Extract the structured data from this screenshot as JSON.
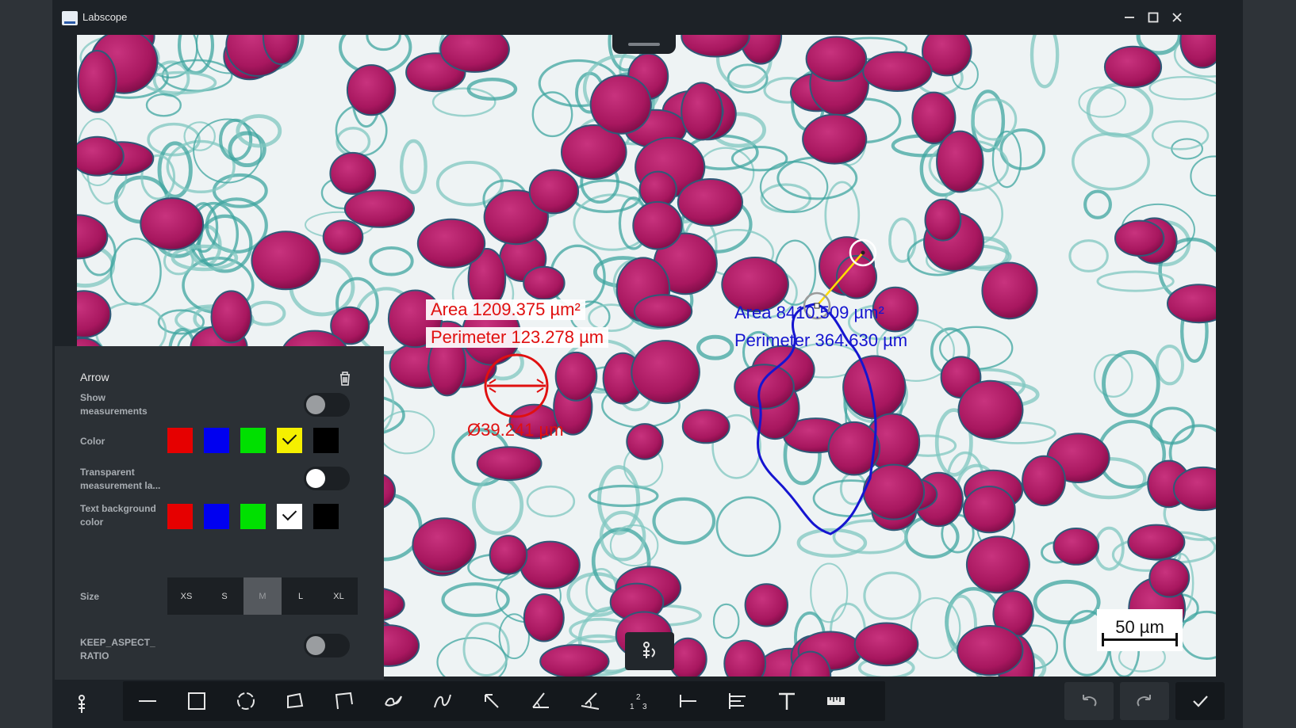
{
  "window": {
    "title": "Labscope",
    "icon": "labscope-app-icon",
    "controls": [
      "minimize-icon",
      "maximize-icon",
      "close-icon"
    ]
  },
  "image": {
    "annotations": {
      "circle": {
        "color": "#e01010",
        "area": "Area 1209.375 µm²",
        "perimeter": "Perimeter 123.278 µm",
        "diameter": "Ø39.241 µm"
      },
      "freehand": {
        "color": "#1515d0",
        "area": "Area 8410.509 µm²",
        "perimeter": "Perimeter 364.630 µm"
      },
      "arrow": {
        "color": "#ffdd00"
      }
    },
    "scale_bar": "50 µm"
  },
  "panel": {
    "title": "Arrow",
    "show_measurements_label": "Show measurements",
    "show_measurements": false,
    "color_label": "Color",
    "colors": [
      "#e60000",
      "#0000f0",
      "#00e000",
      "#f5f000",
      "#000000"
    ],
    "color_selected": 3,
    "transparent_label": "Transparent measurement la...",
    "transparent": true,
    "text_bg_label": "Text background color",
    "text_bg_colors": [
      "#e60000",
      "#0000f0",
      "#00e000",
      "#ffffff",
      "#000000"
    ],
    "text_bg_selected": 3,
    "size_label": "Size",
    "sizes": [
      "XS",
      "S",
      "M",
      "L",
      "XL"
    ],
    "size_selected": "M",
    "keep_aspect_label": "KEEP_ASPECT_RATIO",
    "keep_aspect": false
  },
  "toolbar": {
    "tools": [
      "line-tool-icon",
      "rectangle-tool-icon",
      "circle-tool-icon",
      "polygon-tool-icon",
      "open-polygon-tool-icon",
      "freehand-closed-tool-icon",
      "curve-tool-icon",
      "arrow-tool-icon",
      "angle-tool-icon",
      "four-point-angle-tool-icon",
      "counter-tool-icon",
      "distance-tool-icon",
      "align-tool-icon",
      "text-tool-icon",
      "scale-bar-tool-icon"
    ],
    "actions": [
      "undo-icon",
      "redo-icon",
      "confirm-icon"
    ]
  }
}
